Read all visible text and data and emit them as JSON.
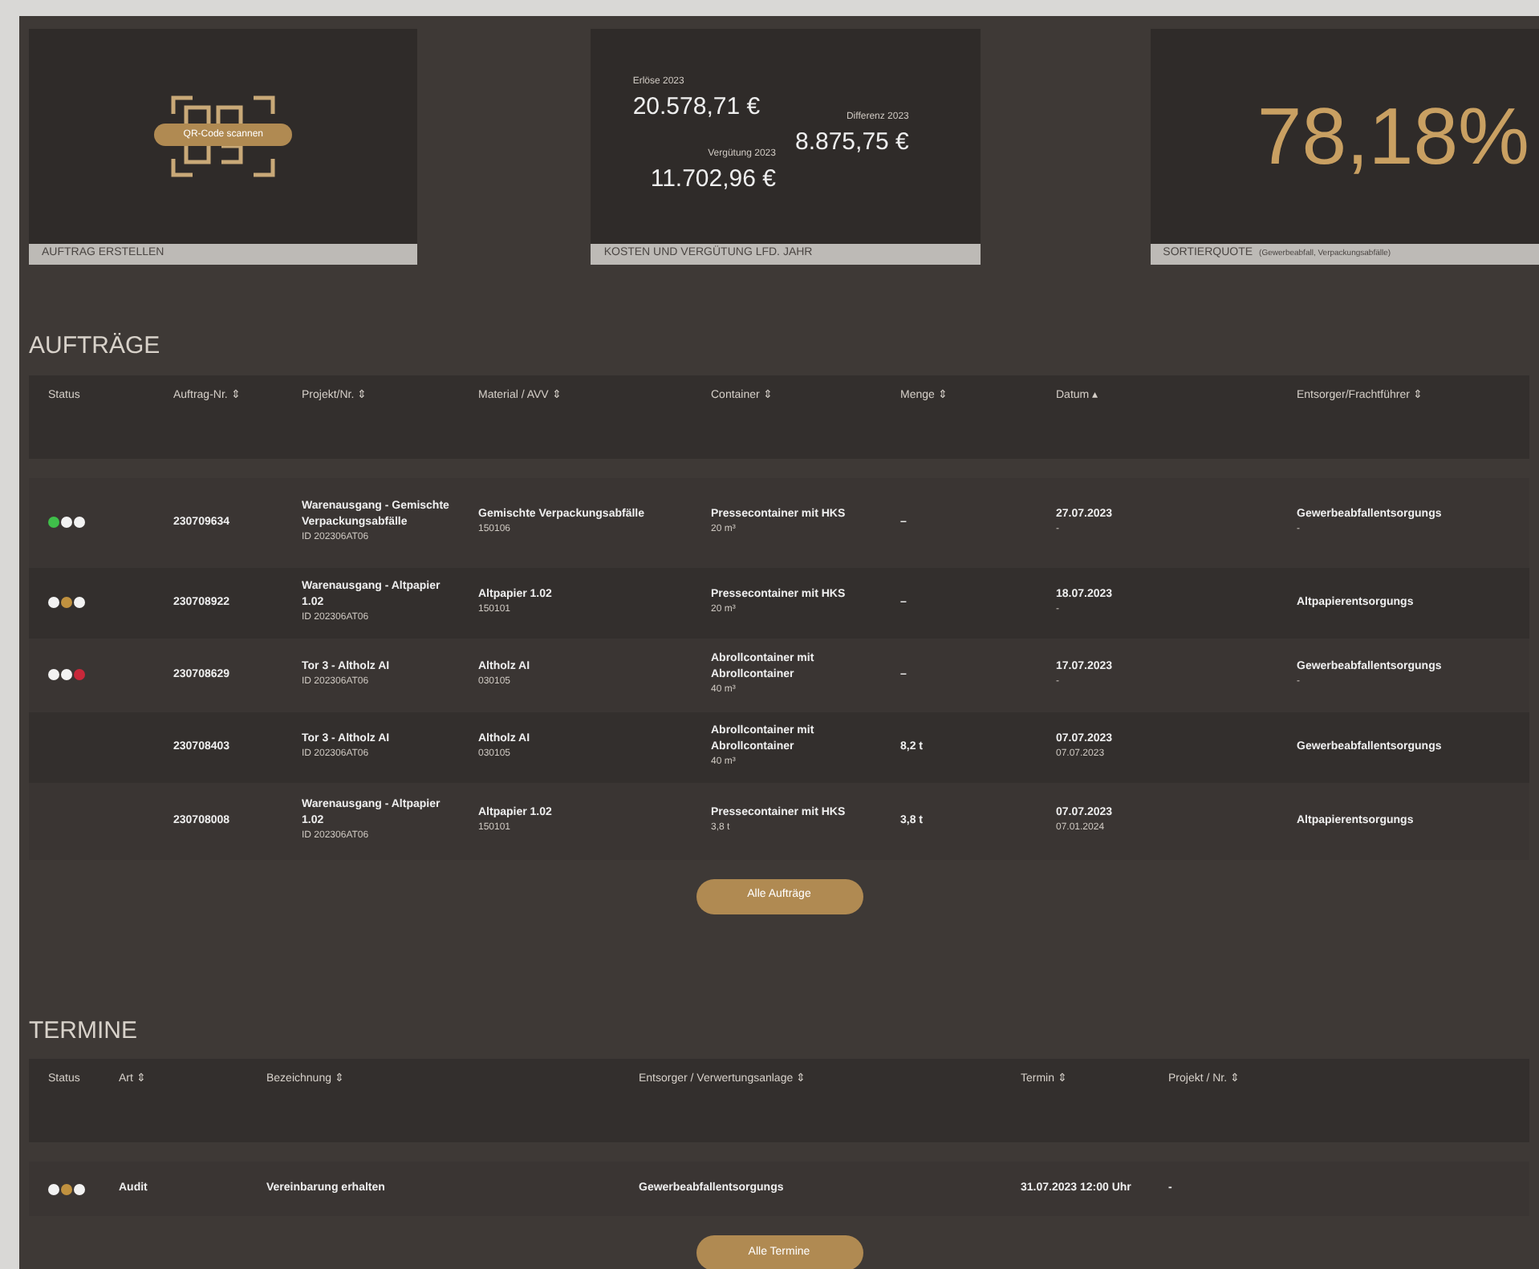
{
  "cards": [
    {
      "kind": "qr",
      "button": "QR-Code scannen",
      "label": "AUFTRAG ERSTELLEN"
    },
    {
      "kind": "costs",
      "label": "KOSTEN UND VERGÜTUNG LFD. JAHR",
      "figures": [
        {
          "caption": "Erlöse 2023",
          "value": "20.578,71 €"
        },
        {
          "caption": "Vergütung 2023",
          "value": "11.702,96 €"
        },
        {
          "caption": "Differenz 2023",
          "value": "8.875,75 €"
        }
      ]
    },
    {
      "kind": "quota",
      "value": "78,18%",
      "label": "SORTIERQUOTE",
      "note": "(Gewerbeabfall, Verpackungsabfälle)"
    }
  ],
  "orders": {
    "title": "AUFTRÄGE",
    "columns": [
      "Status",
      "Auftrag-Nr. ⇕",
      "Projekt/Nr. ⇕",
      "Material / AVV ⇕",
      "Container ⇕",
      "Menge ⇕",
      "Datum ▴",
      "Entsorger/Frachtführer ⇕"
    ],
    "rows": [
      {
        "cells": [
          {
            "kind": "status",
            "dots": [
              {
                "color": "#3fbf4a"
              },
              {
                "color": "#f2f2f2"
              },
              {
                "color": "#f2f2f2"
              }
            ]
          },
          [
            "230709634"
          ],
          [
            "Warenausgang - Gemischte Verpackungsabfälle",
            "ID 202306AT06"
          ],
          [
            "Gemischte Verpackungsabfälle",
            "150106"
          ],
          [
            "Pressecontainer mit HKS",
            "20 m³"
          ],
          [
            "–"
          ],
          [
            "27.07.2023",
            "-"
          ],
          [
            "Gewerbeabfallentsorgungs",
            "-"
          ]
        ]
      },
      {
        "cells": [
          {
            "kind": "status",
            "dots": [
              {
                "color": "#f2f2f2"
              },
              {
                "color": "#c0913f"
              },
              {
                "color": "#f2f2f2"
              }
            ]
          },
          [
            "230708922"
          ],
          [
            "Warenausgang - Altpapier 1.02",
            "ID 202306AT06"
          ],
          [
            "Altpapier 1.02",
            "150101"
          ],
          [
            "Pressecontainer mit HKS",
            "20 m³"
          ],
          [
            "–"
          ],
          [
            "18.07.2023",
            "-"
          ],
          [
            "Altpapierentsorgungs"
          ]
        ]
      },
      {
        "cells": [
          {
            "kind": "status",
            "dots": [
              {
                "color": "#f2f2f2"
              },
              {
                "color": "#f2f2f2"
              },
              {
                "color": "#c8283a"
              }
            ]
          },
          [
            "230708629"
          ],
          [
            "Tor 3 - Altholz AI",
            "ID 202306AT06"
          ],
          [
            "Altholz AI",
            "030105"
          ],
          [
            "Abrollcontainer mit Abrollcontainer",
            "40 m³"
          ],
          [
            "–"
          ],
          [
            "17.07.2023",
            "-"
          ],
          [
            "Gewerbeabfallentsorgungs",
            "-"
          ]
        ]
      },
      {
        "cells": [
          "",
          [
            "230708403"
          ],
          [
            "Tor 3 - Altholz AI",
            "ID 202306AT06"
          ],
          [
            "Altholz AI",
            "030105"
          ],
          [
            "Abrollcontainer mit Abrollcontainer",
            "40 m³"
          ],
          [
            "8,2 t"
          ],
          [
            "07.07.2023",
            "07.07.2023"
          ],
          [
            "Gewerbeabfallentsorgungs"
          ]
        ]
      },
      {
        "cells": [
          "",
          [
            "230708008"
          ],
          [
            "Warenausgang - Altpapier 1.02",
            "ID 202306AT06"
          ],
          [
            "Altpapier 1.02",
            "150101"
          ],
          [
            "Pressecontainer mit HKS",
            "3,8 t"
          ],
          [
            "3,8 t"
          ],
          [
            "07.07.2023",
            "07.01.2024"
          ],
          [
            "Altpapierentsorgungs"
          ]
        ]
      }
    ],
    "button": "Alle Aufträge"
  },
  "appointments": {
    "title": "TERMINE",
    "columns": [
      "Status",
      "Art ⇕",
      "Bezeichnung ⇕",
      "Entsorger / Verwertungsanlage ⇕",
      "Termin ⇕",
      "Projekt / Nr. ⇕"
    ],
    "rows": [
      {
        "cells": [
          {
            "kind": "status",
            "dots": [
              {
                "color": "#f2f2f2"
              },
              {
                "color": "#c0913f"
              },
              {
                "color": "#f2f2f2"
              }
            ]
          },
          [
            "Audit"
          ],
          [
            "Vereinbarung erhalten"
          ],
          [
            "Gewerbeabfallentsorgungs"
          ],
          [
            "31.07.2023 12:00 Uhr"
          ],
          [
            "-"
          ]
        ]
      }
    ],
    "button": "Alle Termine"
  }
}
